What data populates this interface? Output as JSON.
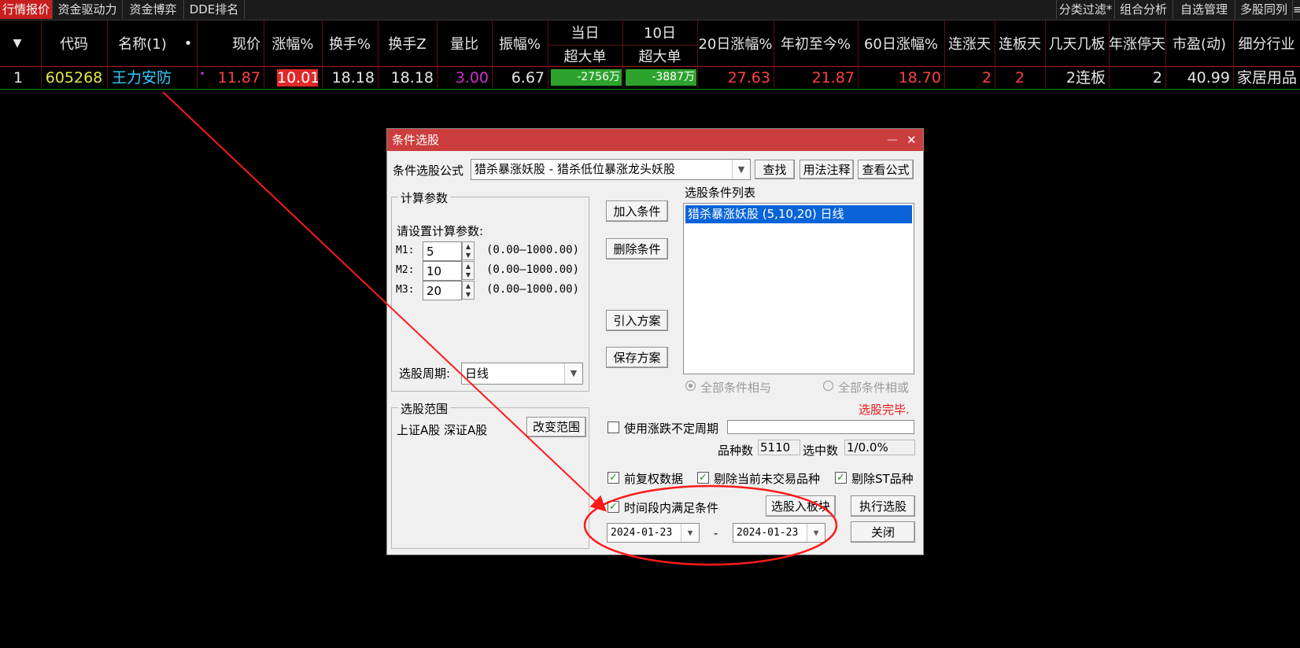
{
  "tabs": {
    "left": [
      "行情报价",
      "资金驱动力",
      "资金博弈",
      "DDE排名"
    ],
    "right": [
      "分类过滤*",
      "组合分析",
      "自选管理",
      "多股同列",
      "≡"
    ]
  },
  "header": {
    "sort": "▼",
    "code": "代码",
    "name": "名称(1)",
    "dot": "•",
    "price": "现价",
    "change": "涨幅%",
    "turnover": "换手%",
    "turnover_z": "换手Z",
    "volume_ratio": "量比",
    "amplitude": "振幅%",
    "today_top": "当日",
    "today_bottom": "超大单",
    "tenday_top": "10日",
    "tenday_bottom": "超大单",
    "chg20": "20日涨幅%",
    "ytd": "年初至今%",
    "chg60": "60日涨幅%",
    "up_days": "连涨天",
    "limit_days": "连板天",
    "boards": "几天几板",
    "year_limit": "年涨停天",
    "pe": "市盈(动)",
    "industry": "细分行业"
  },
  "row": {
    "index": "1",
    "code": "605268",
    "name": "王力安防",
    "dot": "•",
    "price": "11.87",
    "change": "10.01",
    "turnover": "18.18",
    "turnover_z": "18.18",
    "volume_ratio": "3.00",
    "amplitude": "6.67",
    "today_big": "-2756万",
    "tenday_big": "-3887万",
    "chg20": "27.63",
    "ytd": "21.87",
    "chg60": "18.70",
    "up_days": "2",
    "limit_days": "2",
    "boards": "2连板",
    "year_limit": "2",
    "pe": "40.99",
    "industry": "家居用品"
  },
  "dialog": {
    "title": "条件选股",
    "minimize": "—",
    "close": "✕",
    "formula_label": "条件选股公式",
    "formula_value": "猎杀暴涨妖股 - 猎杀低位暴涨龙头妖股",
    "find_btn": "查找",
    "usage_btn": "用法注释",
    "view_btn": "查看公式",
    "calc_group": "计算参数",
    "param_prompt": "请设置计算参数:",
    "params": [
      {
        "label": "M1:",
        "value": "5",
        "range": "(0.00—1000.00)"
      },
      {
        "label": "M2:",
        "value": "10",
        "range": "(0.00—1000.00)"
      },
      {
        "label": "M3:",
        "value": "20",
        "range": "(0.00—1000.00)"
      }
    ],
    "period_label": "选股周期:",
    "period_value": "日线",
    "add_btn": "加入条件",
    "delete_btn": "删除条件",
    "import_btn": "引入方案",
    "save_btn": "保存方案",
    "list_label": "选股条件列表",
    "list_items": [
      "猎杀暴涨妖股 (5,10,20) 日线"
    ],
    "radio_and": "全部条件相与",
    "radio_or": "全部条件相或",
    "status": "选股完毕.",
    "range_group": "选股范围",
    "range_value": "上证A股 深证A股",
    "change_range_btn": "改变范围",
    "use_period_label": "使用涨跌不定周期",
    "count_label": "品种数",
    "count_value": "5110",
    "selected_label": "选中数",
    "selected_value": "1/0.0%",
    "chk_adjust": "前复权数据",
    "chk_exclude_untraded": "剔除当前未交易品种",
    "chk_exclude_st": "剔除ST品种",
    "chk_timespan": "时间段内满足条件",
    "to_block_btn": "选股入板块",
    "execute_btn": "执行选股",
    "date_from": "2024-01-23",
    "date_sep": "-",
    "date_to": "2024-01-23",
    "close_btn": "关闭"
  },
  "colors": {
    "accent_red": "#c81e1e",
    "title_bar": "#cc3d3d",
    "up_red": "#ff4040",
    "code_yellow": "#e8e84a",
    "name_cyan": "#33ccff",
    "ratio_purple": "#cc33cc",
    "bar_green": "#2da32d",
    "selection_blue": "#0a64d8",
    "annotation_red": "#ff1a1a"
  }
}
